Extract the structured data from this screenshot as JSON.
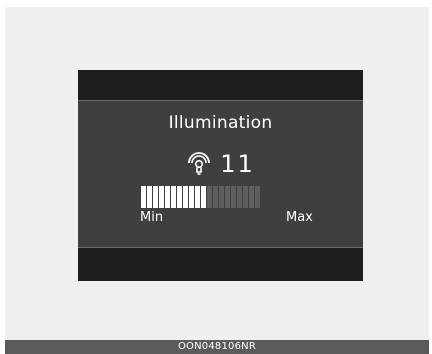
{
  "screen": {
    "title": "Illumination",
    "level": 11,
    "level_text": "11",
    "level_max_segments": 20,
    "min_label": "Min",
    "max_label": "Max",
    "icon": "illumination-bulb-icon"
  },
  "caption": "OON048106NR",
  "colors": {
    "page_bg": "#efefef",
    "display_bg": "#1e1e1e",
    "panel_bg": "#3f3f3f",
    "segment_on": "#ffffff",
    "segment_off": "#5e5e5e",
    "caption_bg": "#5a5a5a"
  }
}
